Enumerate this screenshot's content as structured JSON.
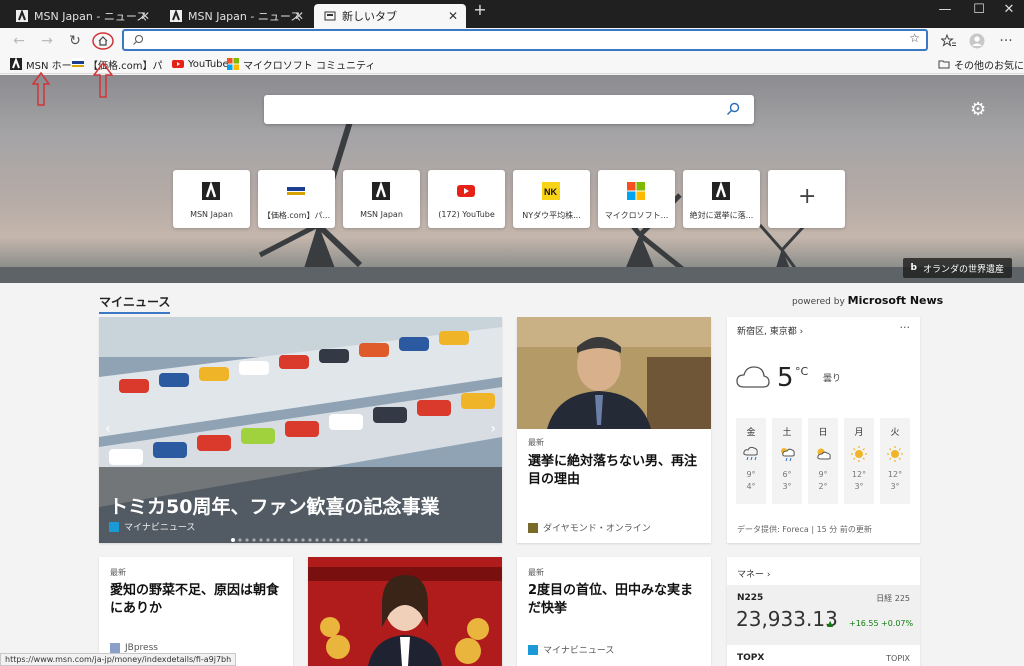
{
  "tabs": [
    {
      "title": "MSN Japan - ニュース, 天気, メール"
    },
    {
      "title": "MSN Japan - ニュース, 天気, メール"
    },
    {
      "title": "新しいタブ"
    }
  ],
  "toolbar": {
    "address_value": ""
  },
  "bookmarks": [
    {
      "label": "MSN ホーム"
    },
    {
      "label": "【価格.com】パソコン..."
    },
    {
      "label": "YouTube"
    },
    {
      "label": "マイクロソフト コミュニティ"
    }
  ],
  "bookmarks_other": "その他のお気に入り",
  "search": {
    "placeholder": ""
  },
  "tiles": [
    {
      "label": "MSN Japan",
      "icon": "msn-icon"
    },
    {
      "label": "【価格.com】パ...",
      "icon": "kakaku-icon"
    },
    {
      "label": "MSN Japan",
      "icon": "msn-icon"
    },
    {
      "label": "(172) YouTube",
      "icon": "youtube-icon"
    },
    {
      "label": "NYダウ平均株...",
      "icon": "nikkei-icon"
    },
    {
      "label": "マイクロソフト...",
      "icon": "microsoft-icon"
    },
    {
      "label": "絶対に選挙に落...",
      "icon": "msn-icon"
    }
  ],
  "hero_credit": "オランダの世界遺産",
  "feed": {
    "my_news": "マイニュース",
    "powered_by": "powered by",
    "powered_brand": "Microsoft News",
    "main_story": {
      "headline": "トミカ50周年、ファン歓喜の記念事業",
      "source": "マイナビニュース"
    },
    "story2": {
      "tag": "最新",
      "headline": "選挙に絶対落ちない男、再注目の理由",
      "source": "ダイヤモンド・オンライン"
    },
    "story3": {
      "tag": "最新",
      "headline": "愛知の野菜不足、原因は朝食にありか",
      "source": "JBpress"
    },
    "story4": {
      "tag": "最新",
      "headline": "2度目の首位、田中みな実まだ快挙",
      "source": "マイナビニュース"
    }
  },
  "weather": {
    "location": "新宿区, 東京都",
    "temp": "5",
    "unit": "°C",
    "condition": "曇り",
    "days": [
      {
        "name": "金",
        "high": "9°",
        "low": "4°",
        "icon": "rain-icon"
      },
      {
        "name": "土",
        "high": "6°",
        "low": "3°",
        "icon": "partly-sunny-rain-icon"
      },
      {
        "name": "日",
        "high": "9°",
        "low": "2°",
        "icon": "partly-cloudy-icon"
      },
      {
        "name": "月",
        "high": "12°",
        "low": "3°",
        "icon": "sun-icon"
      },
      {
        "name": "火",
        "high": "12°",
        "low": "3°",
        "icon": "sun-icon"
      }
    ],
    "footer": "データ提供: Foreca | 15 分 前の更新"
  },
  "money": {
    "title": "マネー",
    "index": "N225",
    "index_label": "日経 225",
    "value": "23,933.13",
    "change": "+16.55",
    "change_pct": "+0.07%",
    "next": "TOPX",
    "next_label": "TOPIX"
  },
  "status_url": "https://www.msn.com/ja-jp/money/indexdetails/fi-a9j7bh",
  "colors": {
    "accent": "#3b78c3",
    "titlebar": "#202020",
    "up": "#107c10",
    "annotation": "#d13438"
  }
}
